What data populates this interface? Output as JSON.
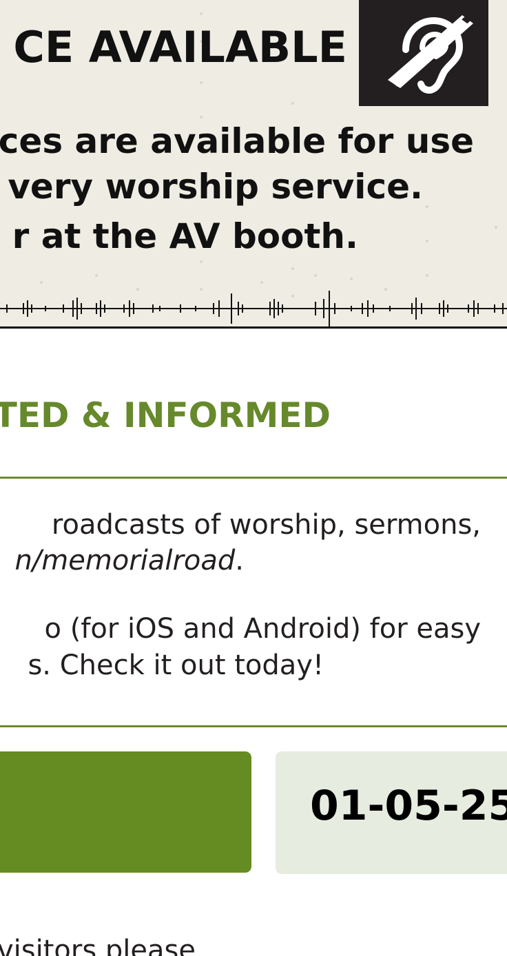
{
  "banner": {
    "title": "CE AVAILABLE",
    "icon": "hearing-assistance-icon",
    "lines": [
      "ces are available for use",
      "very worship service.",
      "r at the AV booth."
    ]
  },
  "section": {
    "heading": "TED & INFORMED",
    "paragraphs": {
      "p1_line1": "roadcasts of worship, sermons,",
      "p1_line2_italic": "n/memorialroad",
      "p1_line2_end": ".",
      "p2_line1": "o (for iOS and Android) for easy",
      "p2_line2": "s. Check it out today!"
    }
  },
  "date_box": {
    "date": "01-05-25"
  },
  "footer": {
    "text": "visitors please"
  },
  "colors": {
    "accent_green": "#658c22",
    "heading_green": "#66892b",
    "date_box_bg": "#e6ecdf",
    "banner_bg": "#efece4"
  }
}
